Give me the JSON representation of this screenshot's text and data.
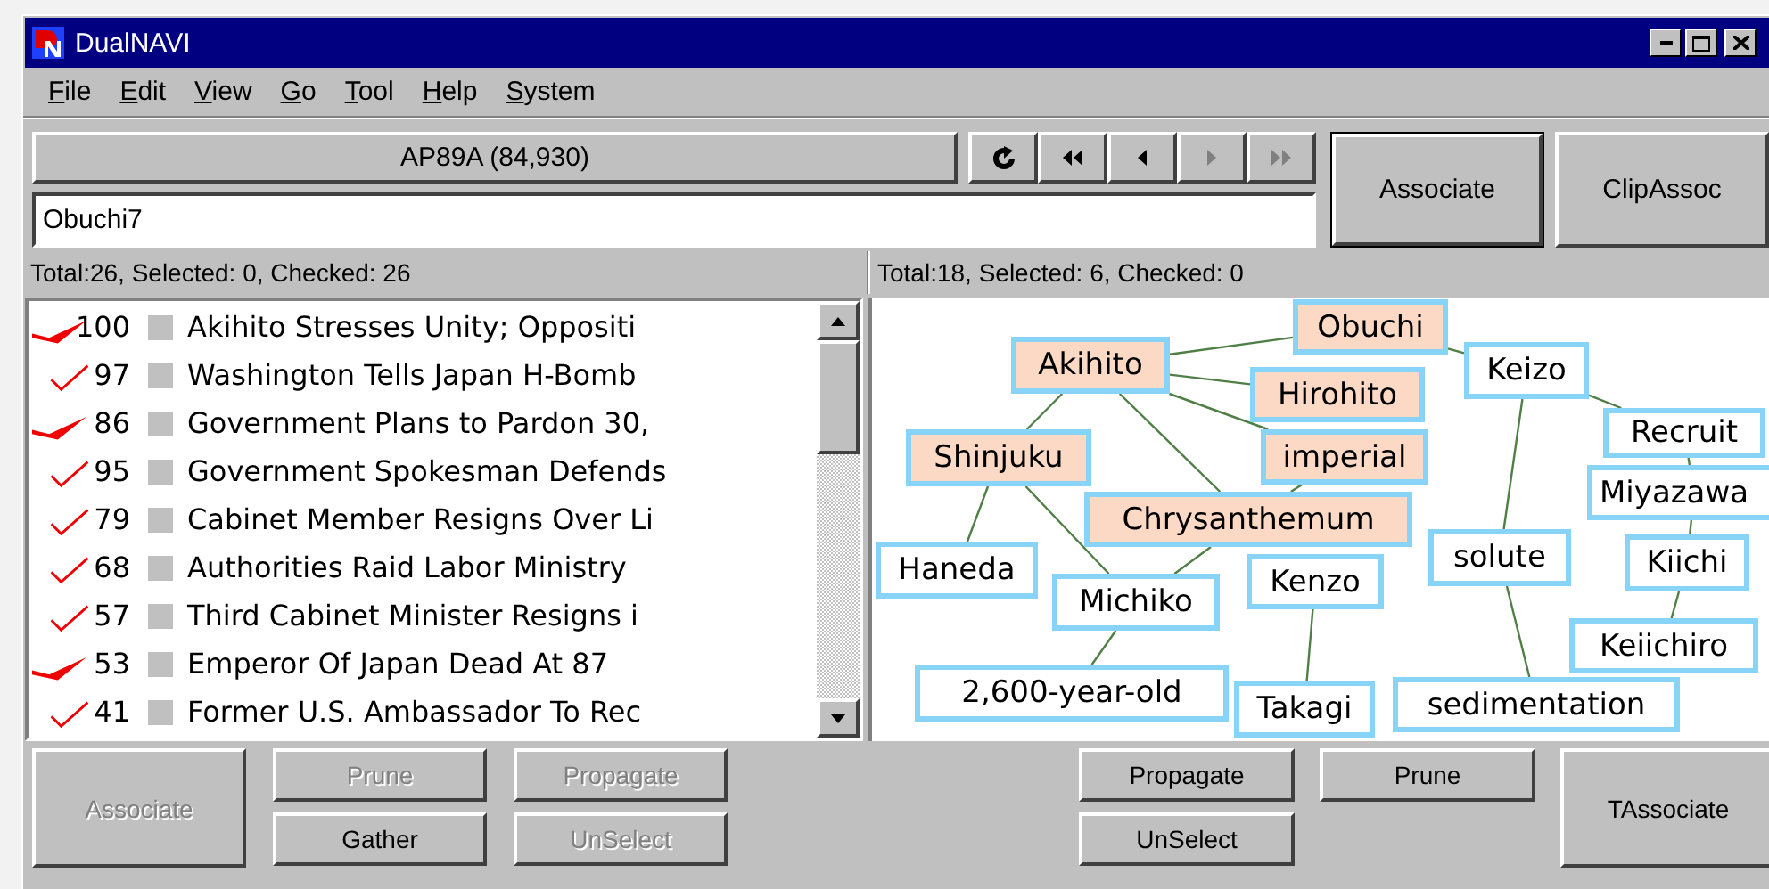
{
  "window": {
    "title": "DualNAVI"
  },
  "menu": [
    {
      "label": "File"
    },
    {
      "label": "Edit"
    },
    {
      "label": "View"
    },
    {
      "label": "Go"
    },
    {
      "label": "Tool"
    },
    {
      "label": "Help"
    },
    {
      "label": "System"
    }
  ],
  "database_button": "AP89A (84,930)",
  "nav_buttons": [
    {
      "kind": "refresh",
      "disabled": false
    },
    {
      "kind": "first",
      "disabled": false
    },
    {
      "kind": "previous",
      "disabled": false
    },
    {
      "kind": "next",
      "disabled": true
    },
    {
      "kind": "last",
      "disabled": true
    }
  ],
  "query_field": {
    "value": "Obuchi7"
  },
  "top_buttons": [
    {
      "label": "Associate",
      "default": true,
      "disabled": false
    },
    {
      "label": "ClipAssoc",
      "default": false,
      "disabled": false
    }
  ],
  "documents": {
    "status": "Total:26,  Selected: 0,  Checked: 26",
    "rows": [
      {
        "score": "100",
        "checked": true,
        "emphasized": true,
        "selected": false,
        "title": "Akihito Stresses Unity; Oppositi"
      },
      {
        "score": "97",
        "checked": true,
        "emphasized": false,
        "selected": false,
        "title": "Washington Tells Japan H-Bomb"
      },
      {
        "score": "86",
        "checked": true,
        "emphasized": true,
        "selected": false,
        "title": "Government Plans to Pardon 30,"
      },
      {
        "score": "95",
        "checked": true,
        "emphasized": false,
        "selected": false,
        "title": "Government Spokesman Defends"
      },
      {
        "score": "79",
        "checked": true,
        "emphasized": false,
        "selected": false,
        "title": "Cabinet Member Resigns Over Li"
      },
      {
        "score": "68",
        "checked": true,
        "emphasized": false,
        "selected": false,
        "title": "Authorities Raid Labor Ministry"
      },
      {
        "score": "57",
        "checked": true,
        "emphasized": false,
        "selected": false,
        "title": "Third Cabinet Minister Resigns i"
      },
      {
        "score": "53",
        "checked": true,
        "emphasized": true,
        "selected": false,
        "title": "Emperor Of Japan Dead At 87"
      },
      {
        "score": "41",
        "checked": true,
        "emphasized": false,
        "selected": false,
        "title": "Former U.S. Ambassador To Rec"
      }
    ]
  },
  "graph": {
    "status": "Total:18,  Selected: 6,  Checked: 0",
    "nodes": [
      {
        "label": "Obuchi",
        "selected": true
      },
      {
        "label": "Akihito",
        "selected": true
      },
      {
        "label": "Hirohito",
        "selected": true
      },
      {
        "label": "Keizo",
        "selected": false
      },
      {
        "label": "Shinjuku",
        "selected": true
      },
      {
        "label": "imperial",
        "selected": true
      },
      {
        "label": "Recruit",
        "selected": false
      },
      {
        "label": "Chrysanthemum",
        "selected": true
      },
      {
        "label": "Miyazawa",
        "selected": false
      },
      {
        "label": "Haneda",
        "selected": false
      },
      {
        "label": "Michiko",
        "selected": false
      },
      {
        "label": "Kenzo",
        "selected": false
      },
      {
        "label": "solute",
        "selected": false
      },
      {
        "label": "Kiichi",
        "selected": false
      },
      {
        "label": "Keiichiro",
        "selected": false
      },
      {
        "label": "2,600-year-old",
        "selected": false
      },
      {
        "label": "Takagi",
        "selected": false
      },
      {
        "label": "sedimentation",
        "selected": false
      }
    ]
  },
  "left_buttons": [
    {
      "label": "Associate",
      "disabled": true
    },
    {
      "label": "Prune",
      "disabled": true
    },
    {
      "label": "Propagate",
      "disabled": true
    },
    {
      "label": "Gather",
      "disabled": false
    },
    {
      "label": "UnSelect",
      "disabled": true
    }
  ],
  "right_buttons": [
    {
      "label": "Propagate",
      "disabled": false
    },
    {
      "label": "Prune",
      "disabled": false
    },
    {
      "label": "TAssociate",
      "disabled": false
    },
    {
      "label": "UnSelect",
      "disabled": false
    }
  ]
}
